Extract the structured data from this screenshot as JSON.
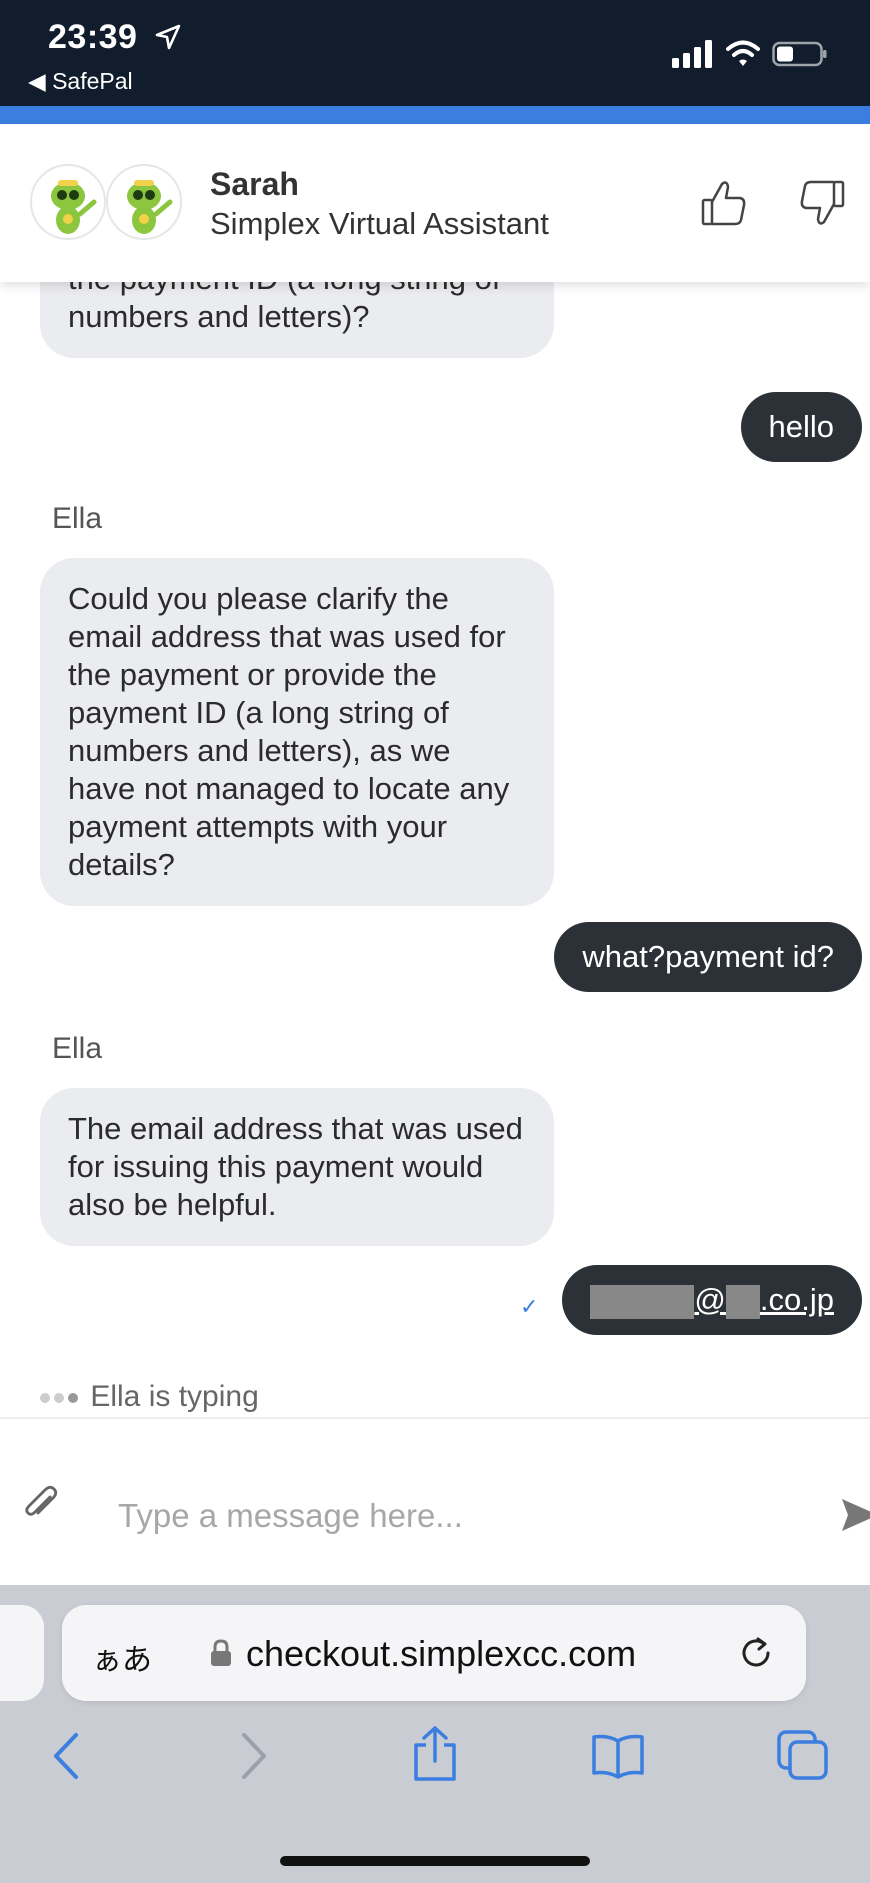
{
  "status_bar": {
    "time": "23:39",
    "back_app": "◀ SafePal"
  },
  "chat_header": {
    "agent_name": "Sarah",
    "agent_title": "Simplex Virtual Assistant"
  },
  "messages": {
    "partial_bot": "the payment ID (a long string of numbers and letters)?",
    "user_1": "hello",
    "sender_1": "Ella",
    "bot_1": "Could you please clarify the email address that was used for the payment or provide the payment ID (a long string of numbers and letters), as we have not managed to locate any payment attempts with your details?",
    "user_2": "what?payment id?",
    "sender_2": "Ella",
    "bot_2": "The email address that was used for issuing this payment would also be helpful.",
    "user_3_at": "@",
    "user_3_domain": ".co.jp",
    "typing": "Ella is typing"
  },
  "composer": {
    "placeholder": "Type a message here..."
  },
  "browser": {
    "text_size": "ぁあ",
    "url": "checkout.simplexcc.com"
  },
  "colors": {
    "status_bg": "#111d2c",
    "accent": "#3b7ee0",
    "user_bubble": "#2b3136",
    "bot_bubble": "#ebecef"
  }
}
